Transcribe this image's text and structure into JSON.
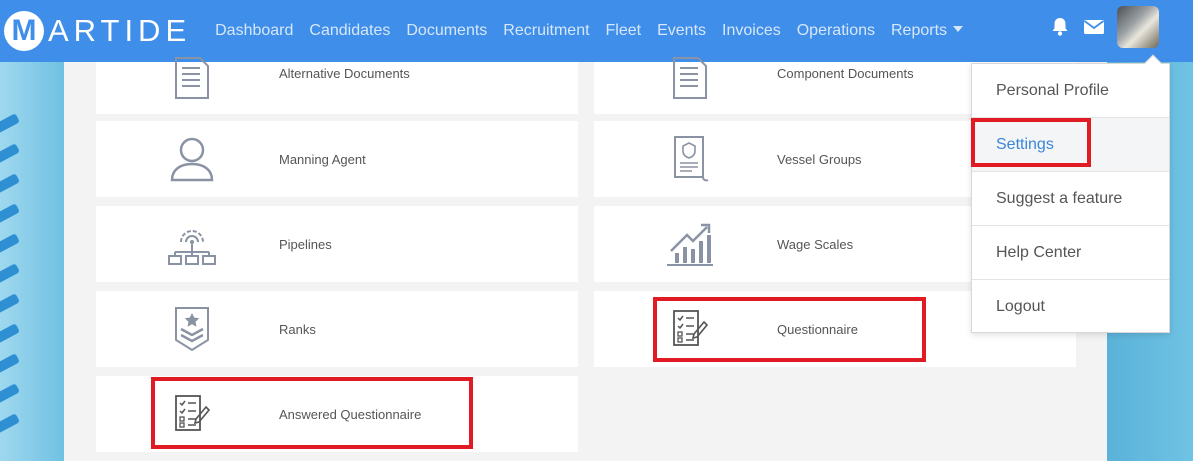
{
  "brand": {
    "logo_letter": "M",
    "name": "ARTIDE"
  },
  "nav": {
    "links": [
      "Dashboard",
      "Candidates",
      "Documents",
      "Recruitment",
      "Fleet",
      "Events",
      "Invoices",
      "Operations",
      "Reports"
    ],
    "icons": [
      "bell-icon",
      "envelope-icon"
    ]
  },
  "cards": [
    {
      "label": "Alternative Documents",
      "icon": "document-icon"
    },
    {
      "label": "Component Documents",
      "icon": "document-icon"
    },
    {
      "label": "Manning Agent",
      "icon": "user-icon"
    },
    {
      "label": "Vessel Groups",
      "icon": "certificate-icon"
    },
    {
      "label": "Pipelines",
      "icon": "network-gear-icon"
    },
    {
      "label": "Wage Scales",
      "icon": "growth-chart-icon"
    },
    {
      "label": "Ranks",
      "icon": "rank-chevron-icon"
    },
    {
      "label": "Questionnaire",
      "icon": "checklist-icon"
    },
    {
      "label": "Answered Questionnaire",
      "icon": "checklist-icon"
    }
  ],
  "user_menu": {
    "items": [
      "Personal Profile",
      "Settings",
      "Suggest a feature",
      "Help Center",
      "Logout"
    ],
    "active": "Settings"
  },
  "colors": {
    "navbar": "#3f8ee9",
    "highlight": "#e01b24",
    "link_active": "#3a86d9"
  }
}
